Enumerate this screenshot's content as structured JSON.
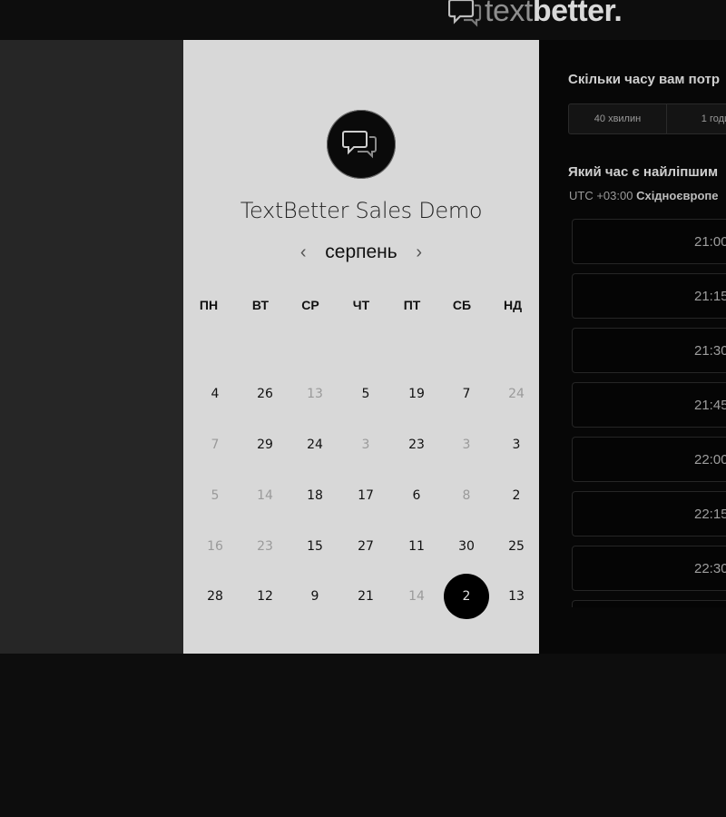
{
  "brand": {
    "logo_light": "text",
    "logo_dark": "better",
    "logo_dot": "."
  },
  "event": {
    "title": "TextBetter Sales Demo",
    "icon": "chat-bubbles-icon"
  },
  "calendar": {
    "month": "серпень",
    "prev_icon": "chevron-left-icon",
    "next_icon": "chevron-right-icon",
    "weekdays": [
      "ПН",
      "ВТ",
      "СР",
      "ЧТ",
      "ПТ",
      "СБ",
      "НД"
    ],
    "weeks": [
      [
        {
          "d": "4",
          "m": false
        },
        {
          "d": "26",
          "m": false
        },
        {
          "d": "13",
          "m": true
        },
        {
          "d": "5",
          "m": false
        },
        {
          "d": "19",
          "m": false
        },
        {
          "d": "7",
          "m": false
        },
        {
          "d": "24",
          "m": true
        }
      ],
      [
        {
          "d": "7",
          "m": true
        },
        {
          "d": "29",
          "m": false
        },
        {
          "d": "24",
          "m": false
        },
        {
          "d": "3",
          "m": true
        },
        {
          "d": "23",
          "m": false
        },
        {
          "d": "3",
          "m": true
        },
        {
          "d": "3",
          "m": false
        }
      ],
      [
        {
          "d": "5",
          "m": true
        },
        {
          "d": "14",
          "m": true
        },
        {
          "d": "18",
          "m": false
        },
        {
          "d": "17",
          "m": false
        },
        {
          "d": "6",
          "m": false
        },
        {
          "d": "8",
          "m": true
        },
        {
          "d": "2",
          "m": false
        }
      ],
      [
        {
          "d": "16",
          "m": true
        },
        {
          "d": "23",
          "m": true
        },
        {
          "d": "15",
          "m": false
        },
        {
          "d": "27",
          "m": false
        },
        {
          "d": "11",
          "m": false
        },
        {
          "d": "30",
          "m": false
        },
        {
          "d": "25",
          "m": false
        }
      ],
      [
        {
          "d": "28",
          "m": false
        },
        {
          "d": "12",
          "m": false
        },
        {
          "d": "9",
          "m": false
        },
        {
          "d": "21",
          "m": false
        },
        {
          "d": "14",
          "m": true
        },
        {
          "d": "2",
          "m": false,
          "selected": true
        },
        {
          "d": "13",
          "m": false
        }
      ]
    ]
  },
  "booking": {
    "duration_question": "Скільки часу вам потр",
    "durations": [
      "40 хвилин",
      "1 годи"
    ],
    "time_question": "Який час є найліпшим",
    "tz_offset": "UTC +03:00",
    "tz_name": "Східноєвропе",
    "slots": [
      "21:00",
      "21:15",
      "21:30",
      "21:45",
      "22:00",
      "22:15",
      "22:30",
      ""
    ]
  }
}
